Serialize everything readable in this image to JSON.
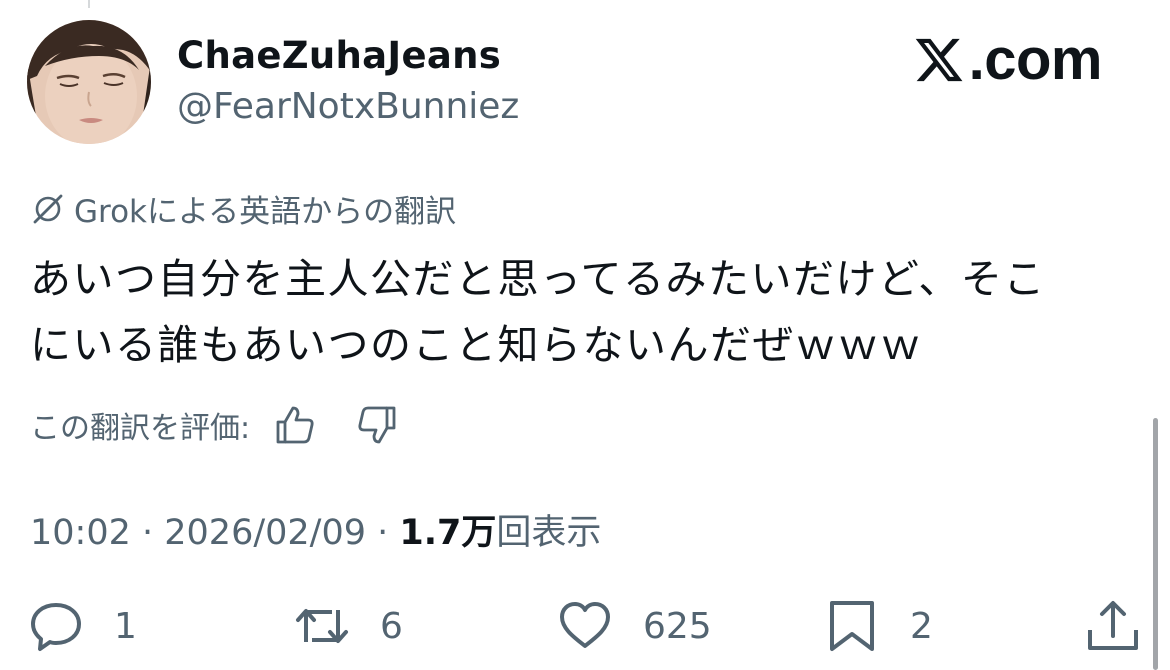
{
  "author": {
    "display_name": "ChaeZuhaJeans",
    "handle": "@FearNotxBunniez"
  },
  "brand": {
    "text": ".com",
    "logo_icon": "x-logo-icon"
  },
  "translation": {
    "icon": "grok-icon",
    "note": "Grokによる英語からの翻訳"
  },
  "tweet": {
    "lines": [
      "あいつ自分を主人公だと思ってるみたいだけど、そこ",
      "にいる誰もあいつのこと知らないんだぜｗｗｗ"
    ]
  },
  "rating": {
    "label": "この翻訳を評価:",
    "thumbs_up_icon": "thumbs-up-icon",
    "thumbs_down_icon": "thumbs-down-icon"
  },
  "meta": {
    "time": "10:02",
    "separator": " · ",
    "date": "2026/02/09",
    "views_count": "1.7万",
    "views_label": "回表示"
  },
  "actions": {
    "reply": {
      "icon": "reply-icon",
      "count": "1"
    },
    "repost": {
      "icon": "repost-icon",
      "count": "6"
    },
    "like": {
      "icon": "heart-icon",
      "count": "625"
    },
    "bookmark": {
      "icon": "bookmark-icon",
      "count": "2"
    },
    "share": {
      "icon": "share-icon"
    }
  },
  "colors": {
    "text_primary": "#0f1419",
    "text_secondary": "#536471",
    "background": "#ffffff"
  }
}
